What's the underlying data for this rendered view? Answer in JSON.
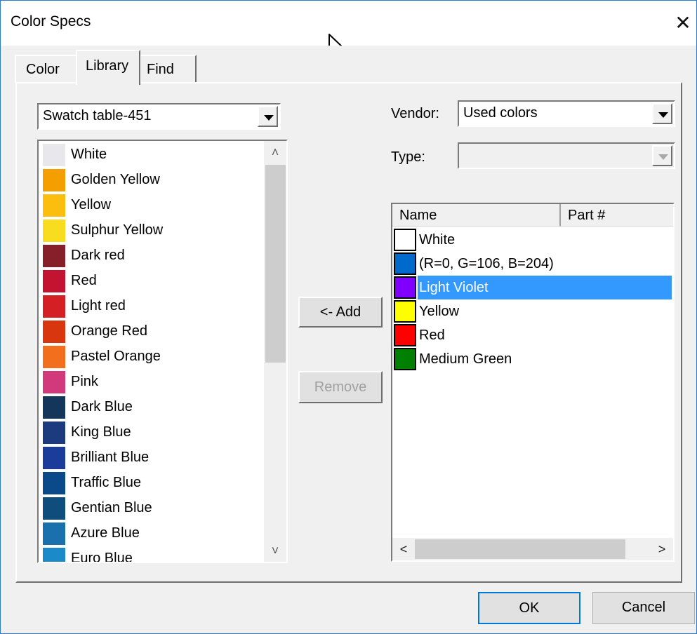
{
  "window": {
    "title": "Color Specs"
  },
  "tabs": [
    {
      "label": "Color",
      "active": false
    },
    {
      "label": "Library",
      "active": true
    },
    {
      "label": "Find",
      "active": false
    }
  ],
  "library": {
    "swatch_table": "Swatch table-451",
    "swatches": [
      {
        "name": "White",
        "color": "#e8e8ec"
      },
      {
        "name": "Golden Yellow",
        "color": "#f59e00"
      },
      {
        "name": "Yellow",
        "color": "#fbbd0e"
      },
      {
        "name": "Sulphur Yellow",
        "color": "#f8dc20"
      },
      {
        "name": "Dark red",
        "color": "#871f2a"
      },
      {
        "name": "Red",
        "color": "#c31330"
      },
      {
        "name": "Light red",
        "color": "#d42025"
      },
      {
        "name": "Orange Red",
        "color": "#d8360f"
      },
      {
        "name": "Pastel Orange",
        "color": "#f26f1d"
      },
      {
        "name": "Pink",
        "color": "#d1397a"
      },
      {
        "name": "Dark Blue",
        "color": "#13365a"
      },
      {
        "name": "King Blue",
        "color": "#1c3b7e"
      },
      {
        "name": "Brilliant Blue",
        "color": "#1b3c9a"
      },
      {
        "name": "Traffic Blue",
        "color": "#0a4a8b"
      },
      {
        "name": "Gentian Blue",
        "color": "#0f4d7d"
      },
      {
        "name": "Azure Blue",
        "color": "#1a6fad"
      },
      {
        "name": "Euro Blue",
        "color": "#1a8ac8"
      }
    ]
  },
  "vendor": {
    "label": "Vendor:",
    "value": "Used colors"
  },
  "type": {
    "label": "Type:",
    "value": ""
  },
  "buttons": {
    "add": "<- Add",
    "remove": "Remove",
    "ok": "OK",
    "cancel": "Cancel"
  },
  "used_colors": {
    "columns": [
      "Name",
      "Part #"
    ],
    "rows": [
      {
        "name": "White",
        "color": "#ffffff",
        "selected": false
      },
      {
        "name": "(R=0, G=106, B=204)",
        "color": "#006acc",
        "selected": false
      },
      {
        "name": "Light Violet",
        "color": "#8000ff",
        "selected": true
      },
      {
        "name": "Yellow",
        "color": "#ffff00",
        "selected": false
      },
      {
        "name": "Red",
        "color": "#ff0000",
        "selected": false
      },
      {
        "name": "Medium Green",
        "color": "#008000",
        "selected": false
      }
    ]
  },
  "colors": {
    "selection": "#3399ff",
    "window_border": "#2b79d0",
    "face": "#f0f0f0"
  }
}
